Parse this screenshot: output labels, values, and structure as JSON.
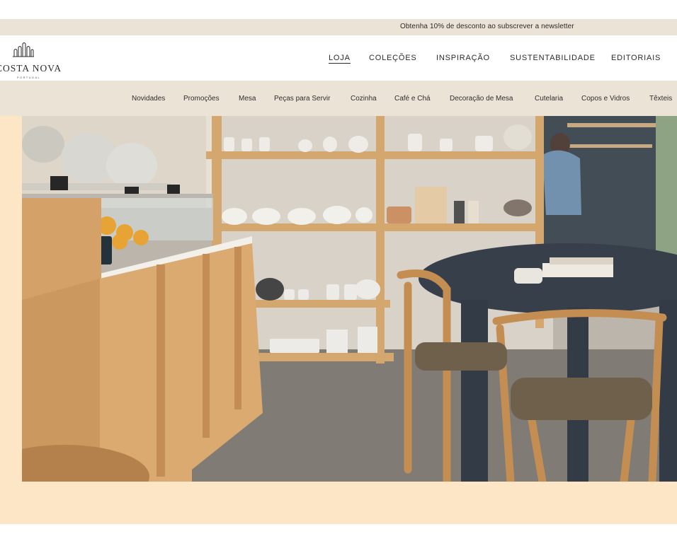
{
  "promo": {
    "text": "Obtenha 10% de desconto ao subscrever a newsletter"
  },
  "brand": {
    "name": "COSTA NOVA",
    "sub": "PORTUGAL",
    "logo_icon": "building-arches-icon"
  },
  "main_nav": [
    {
      "label": "LOJA",
      "active": true
    },
    {
      "label": "COLEÇÕES",
      "active": false
    },
    {
      "label": "INSPIRAÇÃO",
      "active": false
    },
    {
      "label": "SUSTENTABILIDADE",
      "active": false
    },
    {
      "label": "EDITORIAIS",
      "active": false
    }
  ],
  "sub_nav": [
    "Novidades",
    "Promoções",
    "Mesa",
    "Peças para Servir",
    "Cozinha",
    "Café e Chá",
    "Decoração de Mesa",
    "Cutelaria",
    "Copos e Vidros",
    "Têxteis"
  ],
  "hero": {
    "image": "store-interior-photo",
    "colors": {
      "background": "#fde6c6",
      "wood": "#c99a62",
      "table": "#2f3844"
    }
  },
  "colors": {
    "promo_bar": "#ebe4d6",
    "sub_nav_bar": "#ebe4d6",
    "text": "#2a2a2a"
  }
}
